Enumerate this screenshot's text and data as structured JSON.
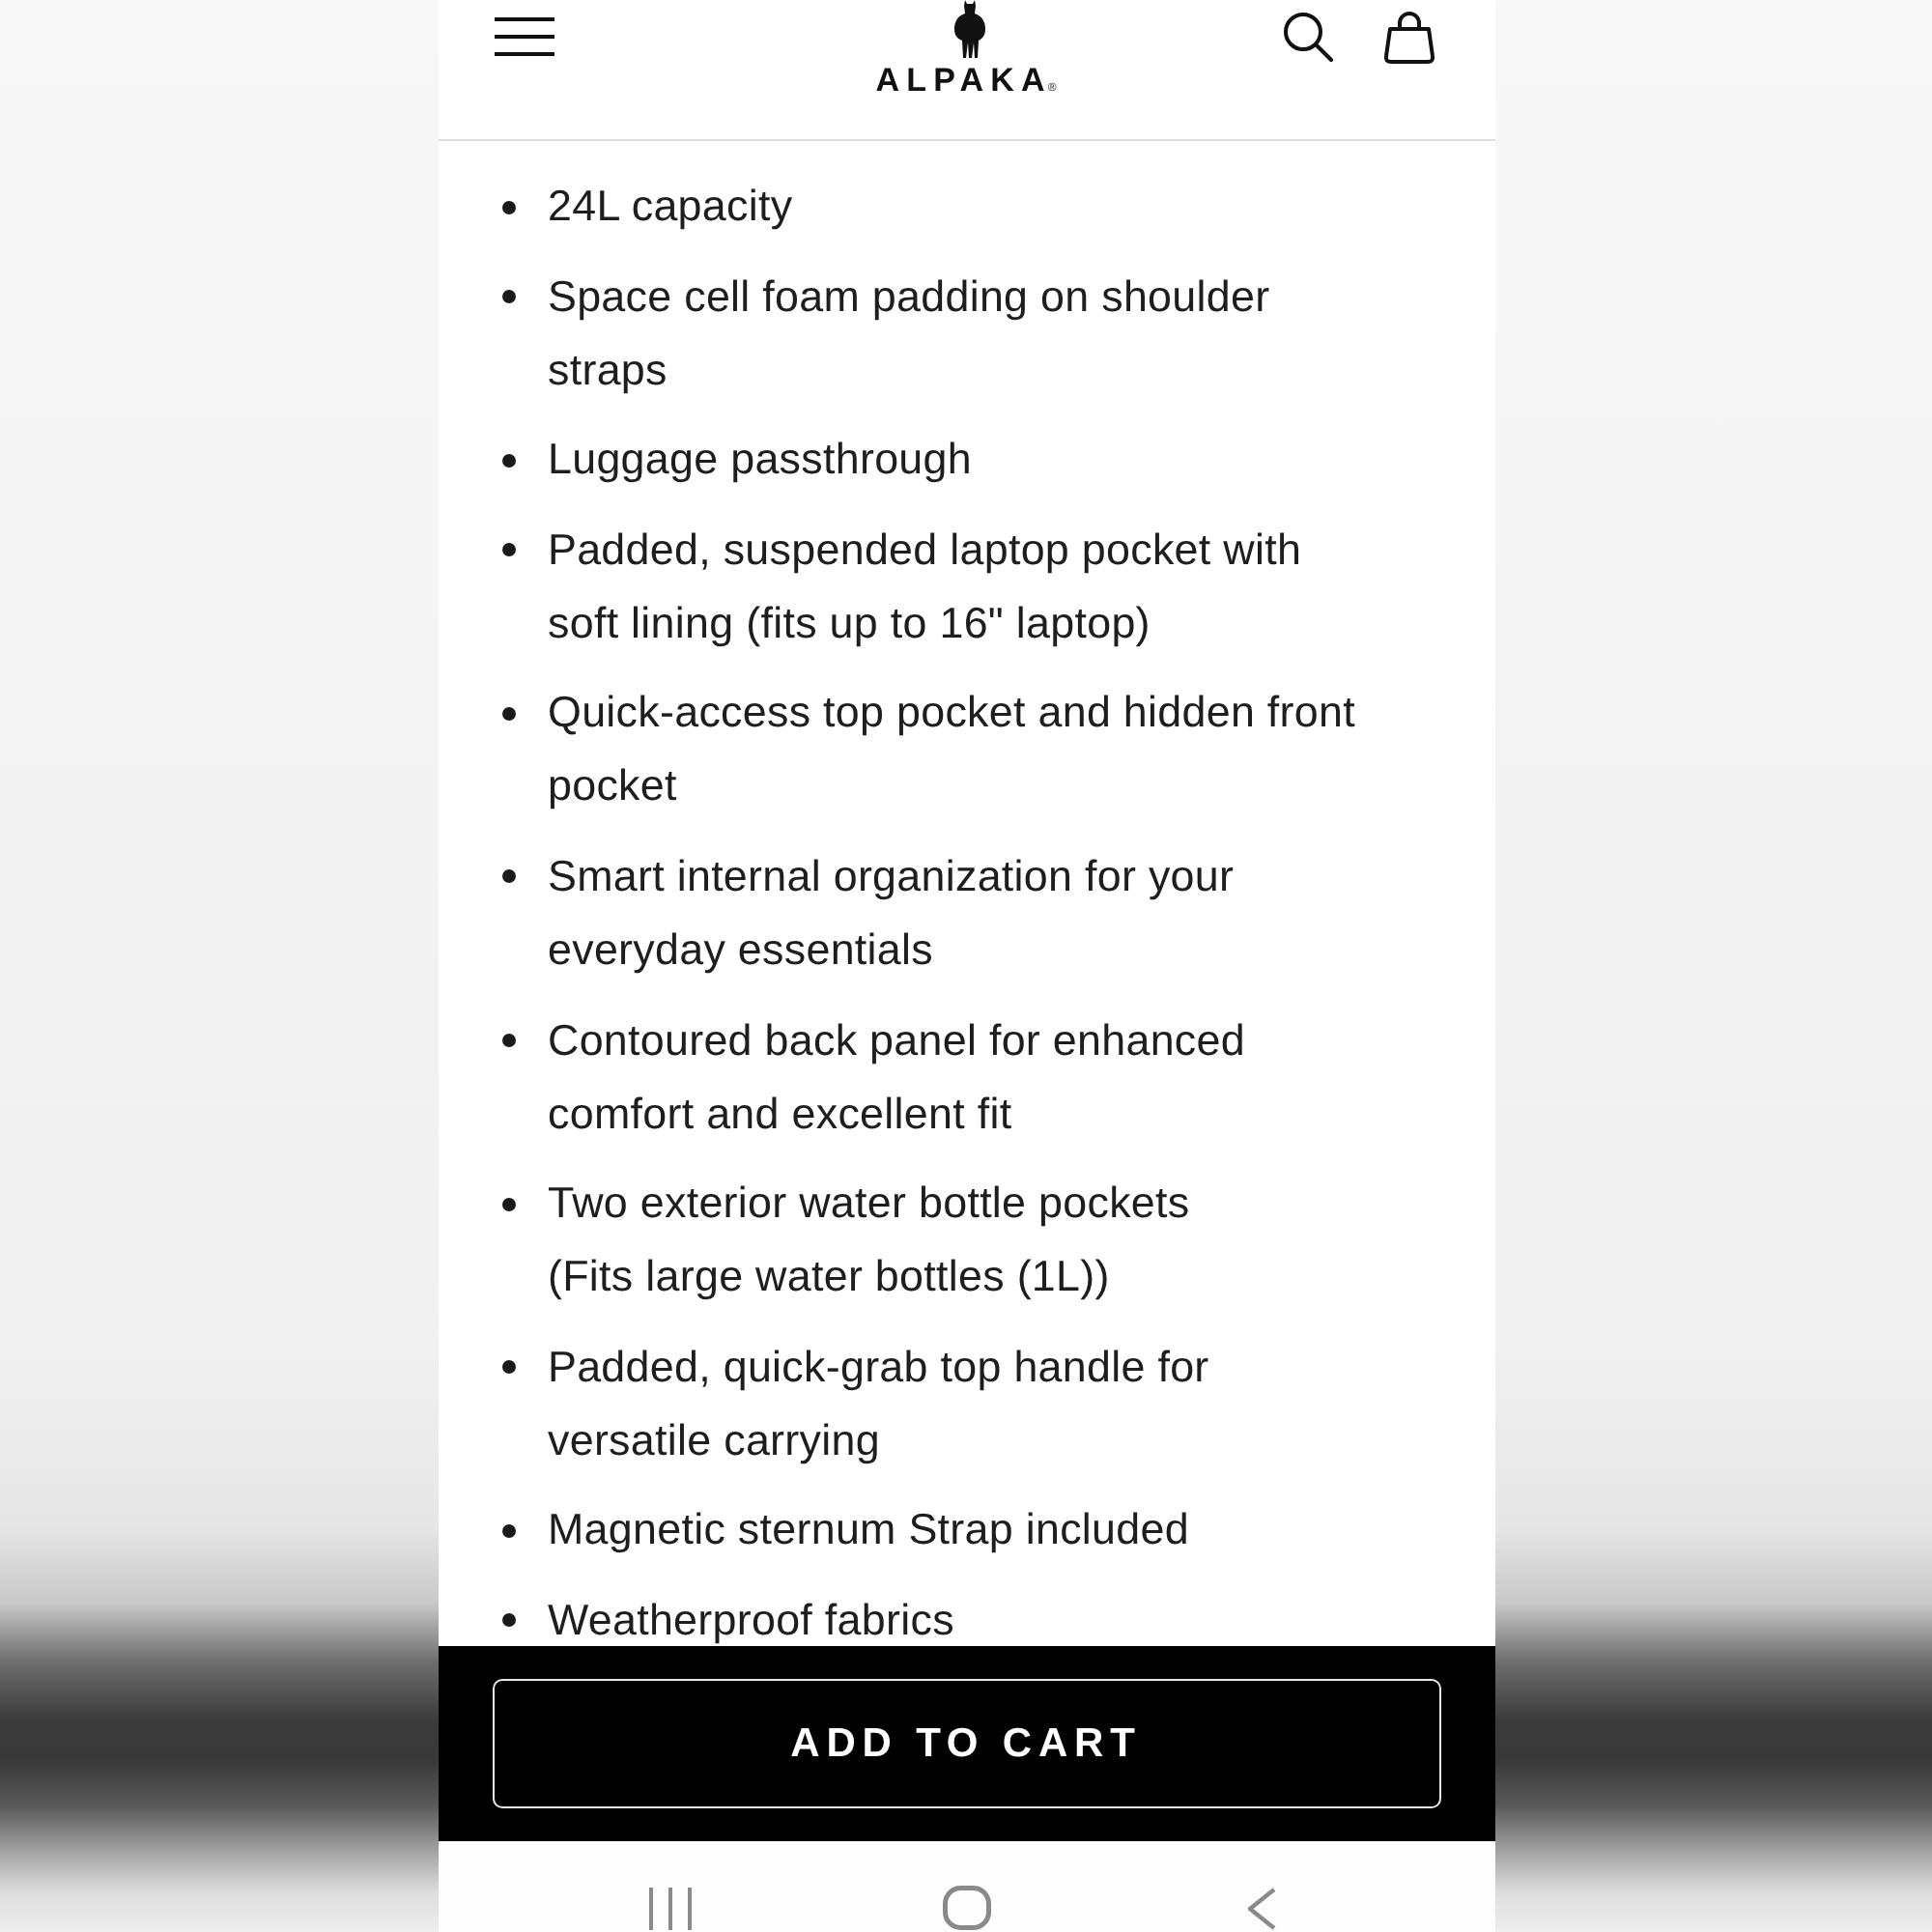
{
  "logo": {
    "wordmark": "ALPAKA",
    "mark": "®"
  },
  "features": [
    {
      "lines": [
        "24L capacity"
      ]
    },
    {
      "lines": [
        "Space cell foam padding on shoulder",
        "straps"
      ]
    },
    {
      "lines": [
        "Luggage passthrough"
      ]
    },
    {
      "lines": [
        "Padded, suspended laptop pocket with",
        "soft lining (fits up to 16\" laptop)"
      ]
    },
    {
      "lines": [
        "Quick-access top pocket and hidden front",
        "pocket"
      ]
    },
    {
      "lines": [
        "Smart internal organization for your",
        "everyday essentials"
      ]
    },
    {
      "lines": [
        "Contoured back panel for enhanced",
        "comfort and excellent fit"
      ]
    },
    {
      "lines": [
        "Two exterior water bottle pockets",
        "(Fits large water bottles (1L))"
      ]
    },
    {
      "lines": [
        "Padded, quick-grab top handle for",
        "versatile carrying"
      ]
    },
    {
      "lines": [
        "Magnetic sternum Strap included"
      ]
    },
    {
      "lines": [
        "Weatherproof fabrics"
      ]
    }
  ],
  "cart_button": {
    "label": "ADD TO CART"
  }
}
